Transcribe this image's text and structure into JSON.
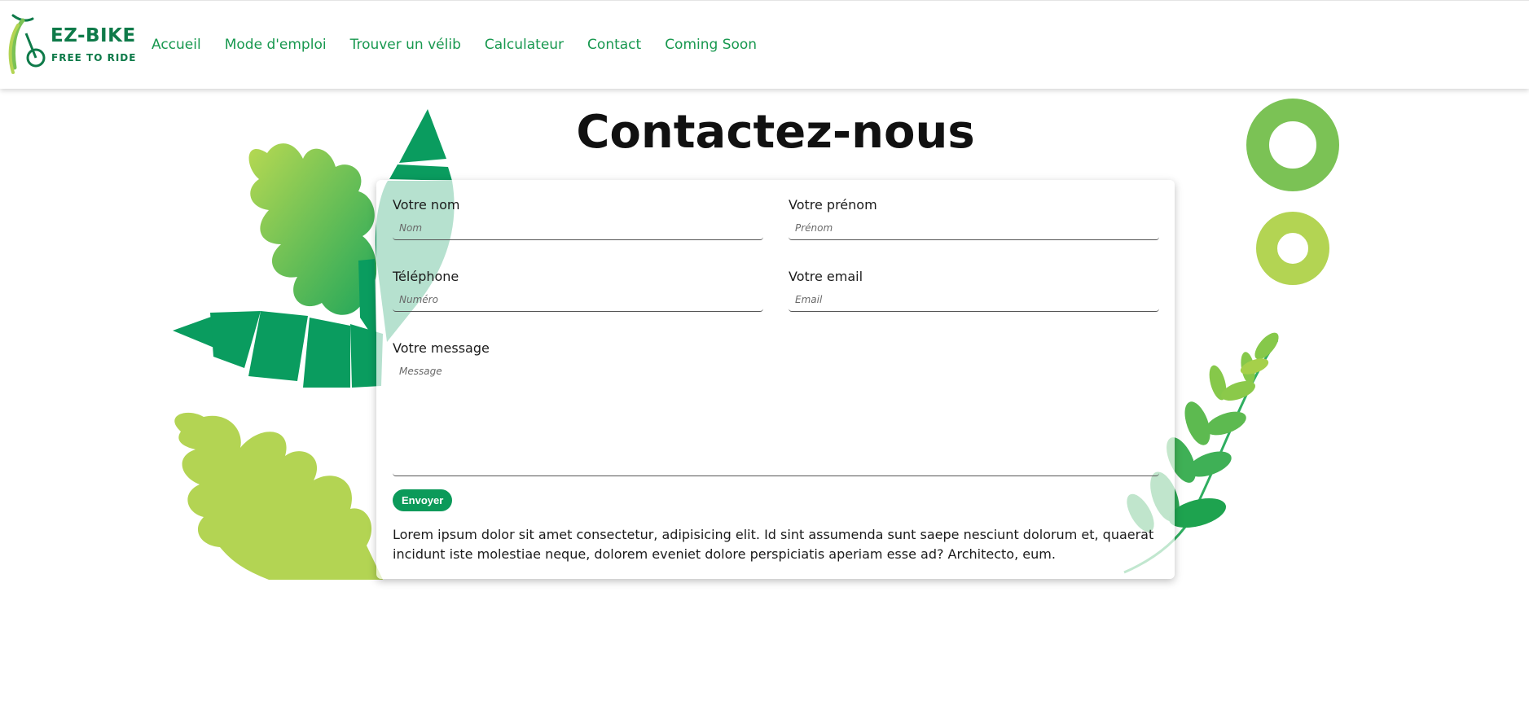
{
  "brand": {
    "name": "EZ-BIKE",
    "tagline": "FREE TO RIDE",
    "colors": {
      "primary": "#0e7a49",
      "accent": "#18984f",
      "button": "#0c9a5a",
      "leaf_light": "#b3d453",
      "leaf_mid": "#7bc255"
    }
  },
  "nav": {
    "items": [
      {
        "label": "Accueil"
      },
      {
        "label": "Mode d'emploi"
      },
      {
        "label": "Trouver un vélib"
      },
      {
        "label": "Calculateur"
      },
      {
        "label": "Contact"
      },
      {
        "label": "Coming Soon"
      }
    ]
  },
  "page": {
    "title": "Contactez-nous"
  },
  "form": {
    "nom": {
      "label": "Votre nom",
      "placeholder": "Nom",
      "value": ""
    },
    "prenom": {
      "label": "Votre prénom",
      "placeholder": "Prénom",
      "value": ""
    },
    "telephone": {
      "label": "Téléphone",
      "placeholder": "Numéro",
      "value": ""
    },
    "email": {
      "label": "Votre email",
      "placeholder": "Email",
      "value": ""
    },
    "message": {
      "label": "Votre message",
      "placeholder": "Message",
      "value": ""
    },
    "submit_label": "Envoyer"
  },
  "footer_text": "Lorem ipsum dolor sit amet consectetur, adipisicing elit. Id sint assumenda sunt saepe nesciunt dolorum et, quaerat incidunt iste molestiae neque, dolorem eveniet dolore perspiciatis aperiam esse ad? Architecto, eum.",
  "icons": [
    "bike-logo-icon"
  ]
}
